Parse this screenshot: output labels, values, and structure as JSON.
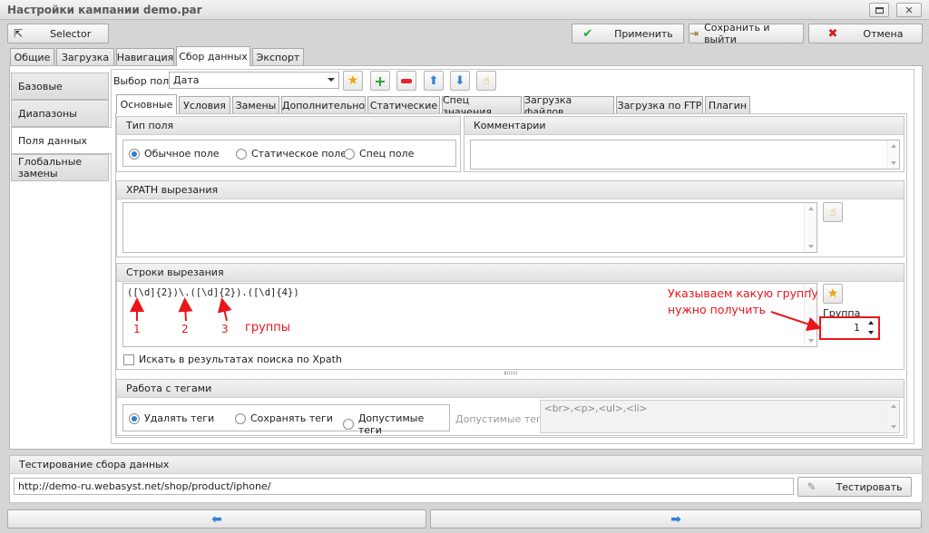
{
  "window": {
    "title": "Настройки кампании demo.par"
  },
  "toolbar": {
    "selector": "Selector",
    "apply": "Применить",
    "save_exit": "Сохранить и выйти",
    "cancel": "Отмена"
  },
  "main_tabs": [
    "Общие",
    "Загрузка",
    "Навигация",
    "Сбор данных",
    "Экспорт"
  ],
  "side_nav": [
    "Базовые",
    "Диапазоны",
    "Поля данных",
    "Глобальные замены"
  ],
  "field_select": {
    "label": "Выбор поля",
    "value": "Дата"
  },
  "sub_tabs": [
    "Основные",
    "Условия",
    "Замены",
    "Дополнительно",
    "Статические",
    "Спец значения",
    "Загрузка файлов",
    "Загрузка по FTP",
    "Плагин"
  ],
  "field_type": {
    "title": "Тип поля",
    "options": [
      "Обычное поле",
      "Статическое поле",
      "Спец поле"
    ]
  },
  "comments": {
    "title": "Комментарии"
  },
  "xpath": {
    "title": "XPATH вырезания"
  },
  "cut_strings": {
    "title": "Строки вырезания",
    "regex": "([\\d]{2})\\.([\\d]{2}).([\\d]{4})",
    "search_in_xpath": "Искать в результатах поиска по Xpath",
    "group_label": "Группа",
    "group_value": "1"
  },
  "annotations": {
    "n1": "1",
    "n2": "2",
    "n3": "3",
    "groups": "группы",
    "hint_line1": "Указываем какую группу",
    "hint_line2": "нужно получить"
  },
  "tags": {
    "title": "Работа с тегами",
    "options": [
      "Удалять теги",
      "Сохранять теги",
      "Допустимые теги"
    ],
    "allowed_label": "Допустимые теги",
    "allowed_value": "<br>,<p>,<ul>,<li>"
  },
  "testing": {
    "title": "Тестирование сбора данных",
    "url": "http://demo-ru.webasyst.net/shop/product/iphone/",
    "button": "Тестировать"
  },
  "colors": {
    "annotation": "#e8161b",
    "accent": "#2a7fd0"
  }
}
